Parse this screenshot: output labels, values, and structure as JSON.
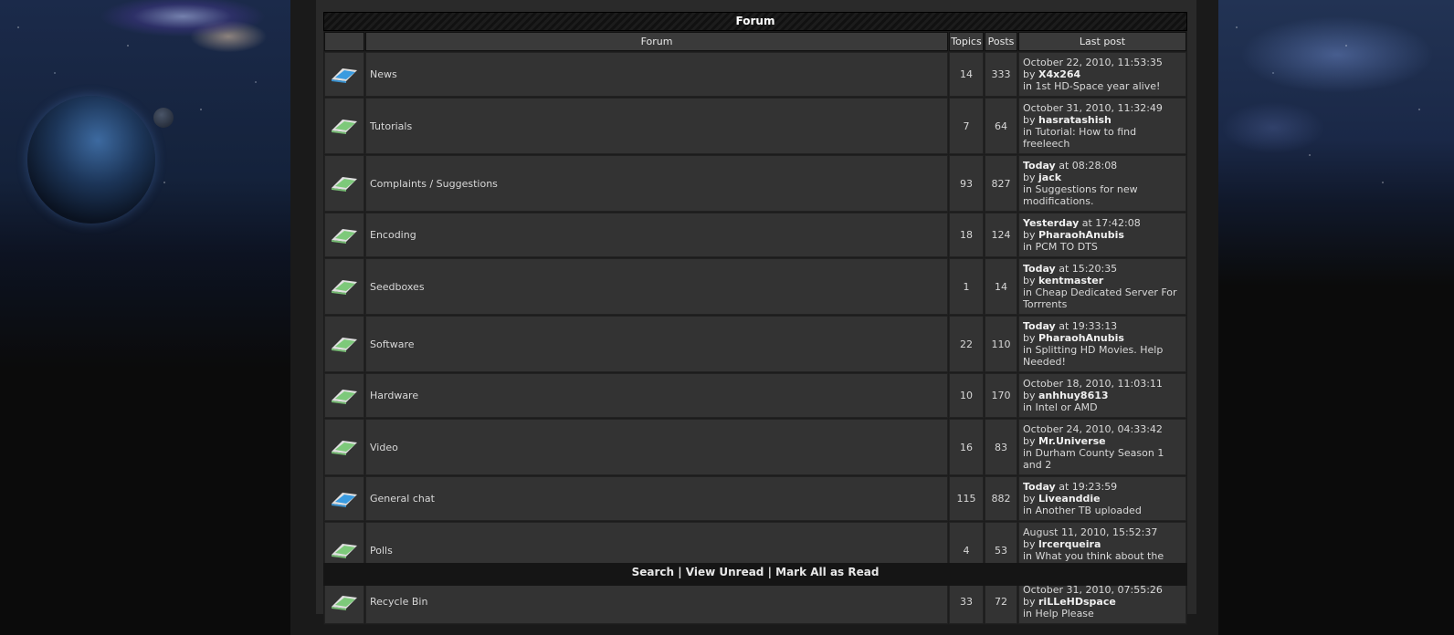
{
  "forum_header": {
    "title": "Forum"
  },
  "columns": {
    "icon": "",
    "forum": "Forum",
    "topics": "Topics",
    "posts": "Posts",
    "last_post": "Last post"
  },
  "colors": {
    "folder_new": "#3a9be0",
    "folder_old": "#7dc97a"
  },
  "forums": [
    {
      "icon": "folder-new-posts-icon",
      "name": "News",
      "topics": "14",
      "posts": "333",
      "last_date_prefix": "",
      "last_date": "October 22, 2010, 11:53:35",
      "by_label": "by ",
      "author": "X4x264",
      "in_label": "in ",
      "topic": "1st HD-Space year alive!"
    },
    {
      "icon": "folder-no-new-posts-icon",
      "name": "Tutorials",
      "topics": "7",
      "posts": "64",
      "last_date_prefix": "",
      "last_date": "October 31, 2010, 11:32:49",
      "by_label": "by ",
      "author": "hasratashish",
      "in_label": "in ",
      "topic": "Tutorial: How to find freeleech"
    },
    {
      "icon": "folder-no-new-posts-icon",
      "name": "Complaints / Suggestions",
      "topics": "93",
      "posts": "827",
      "last_date_prefix": "Today",
      "last_date": " at 08:28:08",
      "by_label": "by ",
      "author": "jack",
      "in_label": "in ",
      "topic": "Suggestions for new modifications."
    },
    {
      "icon": "folder-no-new-posts-icon",
      "name": "Encoding",
      "topics": "18",
      "posts": "124",
      "last_date_prefix": "Yesterday",
      "last_date": " at 17:42:08",
      "by_label": "by ",
      "author": "PharaohAnubis",
      "in_label": "in ",
      "topic": "PCM TO DTS"
    },
    {
      "icon": "folder-no-new-posts-icon",
      "name": "Seedboxes",
      "topics": "1",
      "posts": "14",
      "last_date_prefix": "Today",
      "last_date": " at 15:20:35",
      "by_label": "by ",
      "author": "kentmaster",
      "in_label": "in ",
      "topic": "Cheap Dedicated Server For Torrrents"
    },
    {
      "icon": "folder-no-new-posts-icon",
      "name": "Software",
      "topics": "22",
      "posts": "110",
      "last_date_prefix": "Today",
      "last_date": " at 19:33:13",
      "by_label": "by ",
      "author": "PharaohAnubis",
      "in_label": "in ",
      "topic": "Splitting HD Movies. Help Needed!"
    },
    {
      "icon": "folder-no-new-posts-icon",
      "name": "Hardware",
      "topics": "10",
      "posts": "170",
      "last_date_prefix": "",
      "last_date": "October 18, 2010, 11:03:11",
      "by_label": "by ",
      "author": "anhhuy8613",
      "in_label": "in ",
      "topic": "Intel or AMD"
    },
    {
      "icon": "folder-no-new-posts-icon",
      "name": "Video",
      "topics": "16",
      "posts": "83",
      "last_date_prefix": "",
      "last_date": "October 24, 2010, 04:33:42",
      "by_label": "by ",
      "author": "Mr.Universe",
      "in_label": "in ",
      "topic": "Durham County Season 1 and 2"
    },
    {
      "icon": "folder-new-posts-icon",
      "name": "General chat",
      "topics": "115",
      "posts": "882",
      "last_date_prefix": "Today",
      "last_date": " at 19:23:59",
      "by_label": "by ",
      "author": "Liveanddie",
      "in_label": "in ",
      "topic": "Another TB uploaded"
    },
    {
      "icon": "folder-no-new-posts-icon",
      "name": "Polls",
      "topics": "4",
      "posts": "53",
      "last_date_prefix": "",
      "last_date": "August 11, 2010, 15:52:37",
      "by_label": "by ",
      "author": "lrcerqueira",
      "in_label": "in ",
      "topic": "What you think about the new version?"
    },
    {
      "icon": "folder-no-new-posts-icon",
      "name": "Recycle Bin",
      "topics": "33",
      "posts": "72",
      "last_date_prefix": "",
      "last_date": "October 31, 2010, 07:55:26",
      "by_label": "by ",
      "author": "riLLeHDspace",
      "in_label": "in ",
      "topic": "Help Please"
    }
  ],
  "footer_links": {
    "search": "Search",
    "view_unread": "View Unread",
    "mark_all_read": "Mark All as Read",
    "sep": " | "
  }
}
